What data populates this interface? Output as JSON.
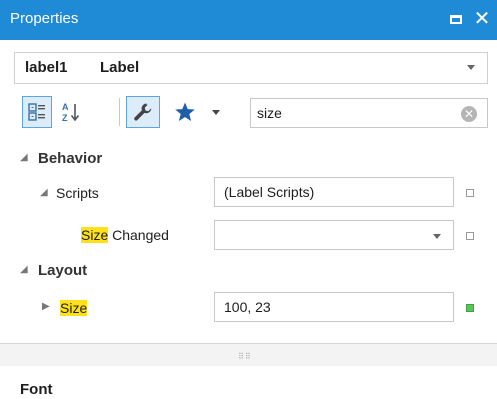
{
  "window": {
    "title": "Properties"
  },
  "object_selector": {
    "name": "label1",
    "type": "Label"
  },
  "search": {
    "value": "size",
    "placeholder": ""
  },
  "toolbar": {
    "categorized_icon": "categorized-icon",
    "alphabetical_icon": "sort-az-icon",
    "properties_icon": "wrench-icon",
    "events_icon": "star-icon"
  },
  "categories": {
    "behavior": {
      "label": "Behavior"
    },
    "layout": {
      "label": "Layout"
    }
  },
  "properties": {
    "scripts": {
      "label": "Scripts",
      "value": "(Label Scripts)"
    },
    "size_changed": {
      "label_highlight": "Size",
      "label_rest": " Changed",
      "value": ""
    },
    "size": {
      "label_highlight": "Size",
      "value": "100, 23"
    }
  },
  "description": {
    "title": "Font"
  },
  "colors": {
    "accent": "#1f8ad6",
    "highlight": "#ffe11a",
    "modified_marker": "#5cc25c"
  }
}
